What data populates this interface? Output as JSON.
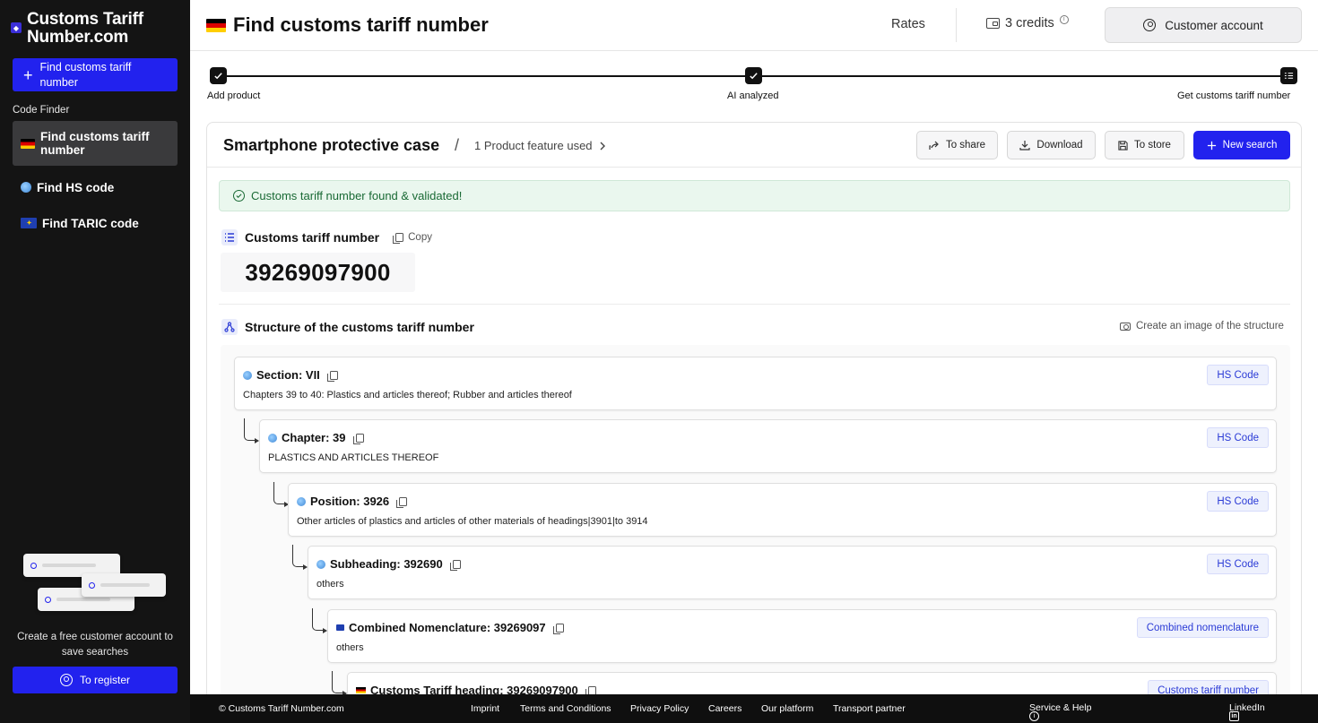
{
  "sidebar": {
    "brand": "Customs Tariff Number.com",
    "cta_label": "Find customs tariff number",
    "section_label": "Code Finder",
    "items": [
      {
        "label": "Find customs tariff number",
        "icon": "flag-germany-icon",
        "active": true
      },
      {
        "label": "Find HS code",
        "icon": "globe-icon",
        "active": false
      },
      {
        "label": "Find TARIC code",
        "icon": "flag-eu-icon",
        "active": false
      }
    ],
    "promo_text": "Create a free customer account to save searches",
    "register_label": "To register"
  },
  "header": {
    "title": "Find customs tariff number",
    "rates_label": "Rates",
    "credits_label": "3 credits",
    "account_label": "Customer account"
  },
  "stepper": {
    "steps": [
      {
        "label": "Add product",
        "state": "done"
      },
      {
        "label": "AI analyzed",
        "state": "done"
      },
      {
        "label": "Get customs tariff number",
        "state": "current"
      }
    ]
  },
  "result": {
    "product_title": "Smartphone protective case",
    "features_label": "1 Product feature used",
    "actions": {
      "share": "To share",
      "download": "Download",
      "store": "To store",
      "new_search": "New search"
    },
    "success_message": "Customs tariff number found & validated!",
    "tariff_section_title": "Customs tariff number",
    "copy_label": "Copy",
    "tariff_number": "39269097900",
    "structure_title": "Structure of the customs tariff number",
    "structure_image_label": "Create an image of the structure",
    "nodes": [
      {
        "title": "Section: VII",
        "desc": "Chapters 39 to 40: Plastics and articles thereof; Rubber and articles thereof",
        "badge": "HS Code",
        "icon": "globe-icon"
      },
      {
        "title": "Chapter: 39",
        "desc": "PLASTICS AND ARTICLES THEREOF",
        "badge": "HS Code",
        "icon": "globe-icon"
      },
      {
        "title": "Position: 3926",
        "desc": "Other articles of plastics and articles of other materials of headings|3901|to 3914",
        "badge": "HS Code",
        "icon": "globe-icon"
      },
      {
        "title": "Subheading: 392690",
        "desc": "others",
        "badge": "HS Code",
        "icon": "globe-icon"
      },
      {
        "title": "Combined Nomenclature: 39269097",
        "desc": "others",
        "badge": "Combined nomenclature",
        "icon": "flag-eu-icon"
      },
      {
        "title": "Customs Tariff heading: 39269097900",
        "desc": "",
        "badge": "Customs tariff number",
        "icon": "flag-germany-icon"
      }
    ]
  },
  "footer": {
    "copyright": "© Customs Tariff Number.com",
    "links": [
      "Imprint",
      "Terms and Conditions",
      "Privacy Policy",
      "Careers",
      "Our platform",
      "Transport partner"
    ],
    "help_label": "Service & Help",
    "social_label": "LinkedIn"
  },
  "colors": {
    "primary": "#2222ee",
    "sidebar_bg": "#141414",
    "success_bg": "#eaf7ee",
    "success_text": "#1a6a35",
    "badge_text": "#2b3bd6"
  }
}
